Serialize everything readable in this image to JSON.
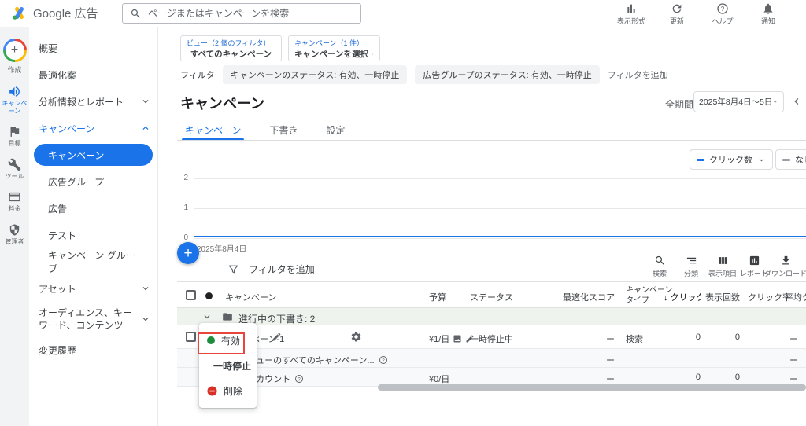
{
  "topbar": {
    "brand": "Google 広告",
    "search": {
      "placeholder": "ページまたはキャンペーンを検索"
    },
    "actions": [
      {
        "label": "表示形式"
      },
      {
        "label": "更新"
      },
      {
        "label": "ヘルプ"
      },
      {
        "label": "通知"
      }
    ]
  },
  "rail": {
    "create_label": "作成",
    "items": [
      {
        "label": "キャンペーン",
        "active": true
      },
      {
        "label": "目標",
        "active": false
      },
      {
        "label": "ツール",
        "active": false
      },
      {
        "label": "料金",
        "active": false
      },
      {
        "label": "管理者",
        "active": false
      }
    ]
  },
  "sidebar": {
    "items": [
      {
        "label": "概要"
      },
      {
        "label": "最適化案"
      },
      {
        "label": "分析情報とレポート",
        "chevron": "down"
      },
      {
        "label": "キャンペーン",
        "chevron": "up",
        "expanded": true
      },
      {
        "label": "キャンペーン",
        "selected": true
      },
      {
        "label": "広告グループ"
      },
      {
        "label": "広告"
      },
      {
        "label": "テスト"
      },
      {
        "label": "キャンペーン グループ"
      },
      {
        "label": "アセット",
        "chevron": "down"
      },
      {
        "label": "オーディエンス、キーワード、コンテンツ",
        "chevron": "down"
      },
      {
        "label": "変更履歴"
      }
    ]
  },
  "view_bar": {
    "view_caption": "ビュー（2 個のフィルタ）",
    "view_value": "すべてのキャンペーン",
    "picker_caption": "キャンペーン（1 件）",
    "picker_value": "キャンペーンを選択"
  },
  "filter_bar": {
    "label": "フィルタ",
    "chips": [
      "キャンペーンのステータス: 有効、一時停止",
      "広告グループのステータス: 有効、一時停止"
    ],
    "add_label": "フィルタを追加"
  },
  "page": {
    "title": "キャンペーン",
    "date_scope": "全期間",
    "date_range": "2025年8月4日～5日"
  },
  "tabs": [
    {
      "label": "キャンペーン",
      "active": true
    },
    {
      "label": "下書き",
      "active": false
    },
    {
      "label": "設定",
      "active": false
    }
  ],
  "chart_data": {
    "type": "line",
    "metric_primary": "クリック数",
    "metric_secondary": "なし",
    "y_ticks": [
      "2",
      "1",
      "0"
    ],
    "ylim": [
      0,
      2
    ],
    "x_tick": "2025年8月4日",
    "series": [
      {
        "name": "クリック数",
        "x": [
          "2025年8月4日",
          "2025年8月5日"
        ],
        "values": [
          0,
          0
        ]
      }
    ],
    "legend_primary_color": "#1a73e8"
  },
  "table": {
    "add_filter_label": "フィルタを追加",
    "tools": [
      {
        "label": "検索"
      },
      {
        "label": "分類"
      },
      {
        "label": "表示項目"
      },
      {
        "label": "レポート"
      },
      {
        "label": "ダウンロード"
      }
    ],
    "columns": {
      "campaign": "キャンペーン",
      "budget": "予算",
      "status": "ステータス",
      "opt_score": "最適化スコア",
      "type_line1": "キャンペーン",
      "type_line2": "タイプ",
      "clicks": "↓ クリック数",
      "impressions": "表示回数",
      "ctr": "クリック率",
      "avg_cpc": "平均クリック単価"
    },
    "group_row_label": "進行中の下書き: 2",
    "rows": [
      {
        "name": "キャンペーン-1",
        "budget": "¥1/日",
        "status": "一時停止中",
        "opt_score": "ー",
        "type": "検索",
        "clicks": "0",
        "impressions": "0",
        "ctr": "ー"
      },
      {
        "name": "合計: ビューのすべてのキャンペーン...",
        "opt_score": "ー",
        "ctr": "ー"
      },
      {
        "name": "合計: アカウント",
        "budget": "¥0/日",
        "opt_score": "ー",
        "clicks": "0",
        "impressions": "0",
        "ctr": "ー"
      }
    ]
  },
  "status_menu": {
    "items": [
      {
        "label": "有効",
        "highlighted": true
      },
      {
        "label": "一時停止",
        "highlighted": false
      },
      {
        "label": "削除",
        "highlighted": false
      }
    ]
  },
  "colors": {
    "accent": "#1a73e8",
    "enabled_green": "#1e8e3e",
    "removed_red": "#d93025",
    "annotation_red": "#e8453c"
  }
}
